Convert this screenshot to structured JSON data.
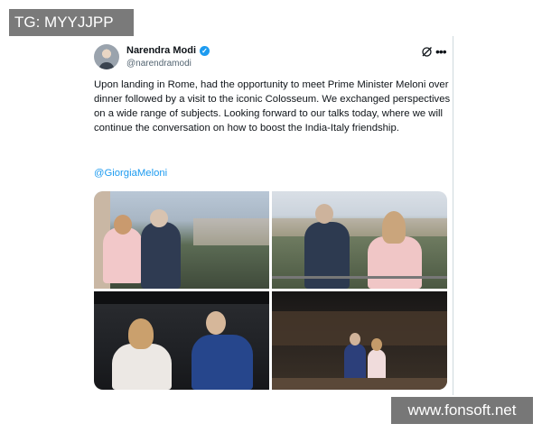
{
  "watermarks": {
    "top_left": "TG: MYYJJPP",
    "bottom_right": "www.fonsoft.net"
  },
  "post": {
    "author_name": "Narendra Modi",
    "author_handle": "@narendramodi",
    "verified": true,
    "text": "Upon landing in Rome, had the opportunity to meet Prime Minister Meloni over dinner followed by a visit to the iconic Colosseum. We exchanged perspectives on a wide range of subjects. Looking forward to our talks today, where we will continue the conversation on how to boost the India-Italy friendship.",
    "mention": "@GiorgiaMeloni",
    "photo_count": 4
  },
  "icons": {
    "verified": "verified-badge-icon",
    "grok": "grok-icon",
    "more": "more-options-icon"
  },
  "colors": {
    "link": "#1d9bf0",
    "text": "#0f1419",
    "muted": "#536471"
  }
}
